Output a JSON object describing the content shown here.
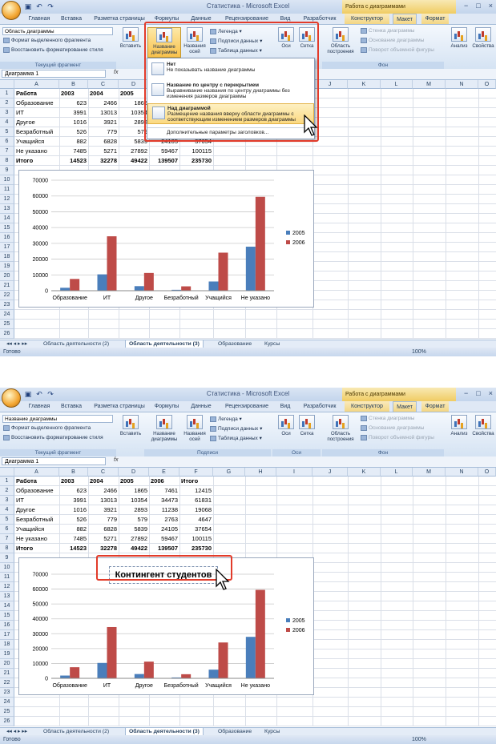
{
  "window": {
    "title": "Статистика - Microsoft Excel",
    "context_title": "Работа с диаграммами",
    "buttons": [
      "−",
      "□",
      "×"
    ]
  },
  "tabs": [
    "Главная",
    "Вставка",
    "Разметка страницы",
    "Формулы",
    "Данные",
    "Рецензирование",
    "Вид",
    "Разработчик",
    "Конструктор",
    "Макет",
    "Формат"
  ],
  "active_tab": "Макет",
  "ribbon": {
    "selector_top": "Область диаграммы",
    "selector_bottom": "Название диаграммы",
    "format_selection": "Формат выделенного фрагмента",
    "reset_style": "Восстановить форматирование стиля",
    "group_current": "Текущий фрагмент",
    "insert": "Вставить",
    "chart_title": "Название диаграммы",
    "axis_titles": "Названия осей",
    "legend": "Легенда",
    "data_labels": "Подписи данных",
    "data_table": "Таблица данных",
    "group_labels": "Подписи",
    "axes": "Оси",
    "gridlines": "Сетка",
    "group_axes": "Оси",
    "plot_area": "Область построения",
    "chart_wall": "Стенка диаграммы",
    "chart_floor": "Основание диаграммы",
    "rotation_3d": "Поворот объемной фигуры",
    "group_background": "Фон",
    "analysis": "Анализ",
    "properties": "Свойства"
  },
  "dropdown": {
    "items": [
      {
        "title": "Нет",
        "desc": "Не показывать название диаграммы"
      },
      {
        "title": "Название по центру с перекрытием",
        "desc": "Выравнивание названия по центру диаграммы без изменения размеров диаграммы"
      },
      {
        "title": "Над диаграммой",
        "desc": "Размещение названия вверху области диаграммы с соответствующим изменением размеров диаграммы"
      }
    ],
    "more": "Дополнительные параметры заголовков..."
  },
  "namebox": "Диаграмма 1",
  "fx": "fx",
  "columns": [
    "A",
    "B",
    "C",
    "D",
    "E",
    "F",
    "G",
    "H",
    "I",
    "J",
    "K",
    "L",
    "M",
    "N",
    "O"
  ],
  "rows": [
    "1",
    "2",
    "3",
    "4",
    "5",
    "6",
    "7",
    "8",
    "9",
    "10",
    "11",
    "12",
    "13",
    "14",
    "15",
    "16",
    "17",
    "18",
    "19",
    "20",
    "21",
    "22",
    "23",
    "24",
    "25",
    "26"
  ],
  "table": {
    "header": [
      "Работа",
      "2003",
      "2004",
      "2005",
      "2006",
      "Итого"
    ],
    "data": [
      [
        "Образование",
        "623",
        "2466",
        "1865",
        "7461",
        "12415"
      ],
      [
        "ИТ",
        "3991",
        "13013",
        "10354",
        "34473",
        "61831"
      ],
      [
        "Другое",
        "1016",
        "3921",
        "2893",
        "11238",
        "19068"
      ],
      [
        "Безработный",
        "526",
        "779",
        "579",
        "2763",
        "4647"
      ],
      [
        "Учащийся",
        "882",
        "6828",
        "5839",
        "24105",
        "37654"
      ],
      [
        "Не указано",
        "7485",
        "5271",
        "27892",
        "59467",
        "100115"
      ],
      [
        "Итого",
        "14523",
        "32278",
        "49422",
        "139507",
        "235730"
      ]
    ]
  },
  "chart_data": {
    "type": "bar",
    "title": "Контингент студентов",
    "categories": [
      "Образование",
      "ИТ",
      "Другое",
      "Безработный",
      "Учащийся",
      "Не указано"
    ],
    "series": [
      {
        "name": "2005",
        "values": [
          1865,
          10354,
          2893,
          579,
          5839,
          27892
        ],
        "color": "#4a7ebb"
      },
      {
        "name": "2006",
        "values": [
          7461,
          34473,
          11238,
          2763,
          24105,
          59467
        ],
        "color": "#be4b48"
      }
    ],
    "ylim": [
      0,
      70000
    ],
    "yticks": [
      "0",
      "10000",
      "20000",
      "30000",
      "40000",
      "50000",
      "60000",
      "70000"
    ],
    "grid": true,
    "legend": "right"
  },
  "sheet_tabs": [
    "Область деятельности (2)",
    "Область деятельности (3)",
    "Образование",
    "Курсы"
  ],
  "active_sheet": "Область деятельности (3)",
  "status": {
    "ready": "Готово",
    "zoom": "100%"
  }
}
